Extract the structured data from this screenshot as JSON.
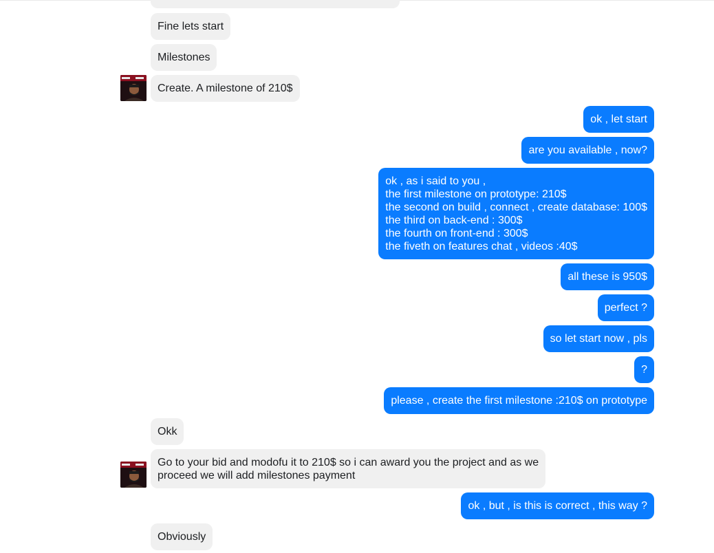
{
  "accent_color": "#0a7cff",
  "incoming_bubble_color": "#f0f0f0",
  "avatar_icon": "user-avatar-photo",
  "messages": [
    {
      "sender": "other",
      "text": "Fine lets start"
    },
    {
      "sender": "other",
      "text": "Milestones"
    },
    {
      "sender": "other",
      "text": "Create. A milestone of 210$"
    },
    {
      "sender": "me",
      "text": "ok , let start"
    },
    {
      "sender": "me",
      "text": "are you available , now?"
    },
    {
      "sender": "me",
      "lines": [
        "ok , as i said to you ,",
        "the first milestone on prototype: 210$",
        "the second on build , connect , create database: 100$",
        "the third on back-end : 300$",
        "the fourth on front-end : 300$",
        "the fiveth on features chat , videos :40$"
      ]
    },
    {
      "sender": "me",
      "text": "all these is 950$"
    },
    {
      "sender": "me",
      "text": "perfect ?"
    },
    {
      "sender": "me",
      "text": "so let start now , pls"
    },
    {
      "sender": "me",
      "text": "?"
    },
    {
      "sender": "me",
      "text": "please , create the first milestone :210$ on prototype"
    },
    {
      "sender": "other",
      "text": "Okk"
    },
    {
      "sender": "other",
      "lines": [
        "Go to your bid and modofu it to 210$ so i can award you the project and as we",
        "proceed we will add milestones payment"
      ]
    },
    {
      "sender": "me",
      "text": "ok , but , is this is correct , this way ?"
    },
    {
      "sender": "other",
      "text": "Obviously"
    }
  ]
}
